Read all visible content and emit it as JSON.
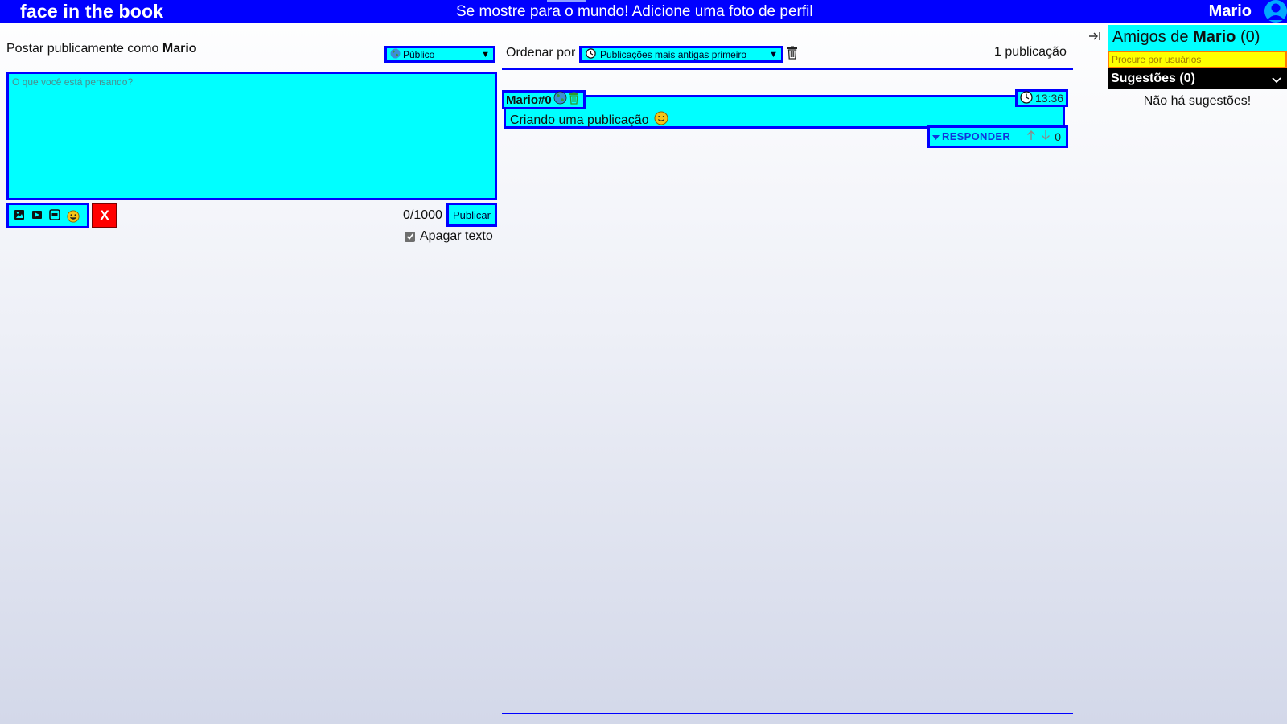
{
  "header": {
    "brand": "face in the book",
    "banner": "Se mostre para o mundo! Adicione uma foto de perfil",
    "user_name": "Mario"
  },
  "composer": {
    "title_prefix": "Postar publicamente como",
    "title_user": "Mario",
    "privacy": {
      "selected": "Público",
      "icon": "globe-icon"
    },
    "placeholder": "O que você está pensando?",
    "text": "",
    "media_buttons": [
      "image-icon",
      "video-icon",
      "gif-icon",
      "emoji-icon"
    ],
    "clear_label": "X",
    "char_count": "0/1000",
    "publish_label": "Publicar",
    "clear_text_label": "Apagar texto",
    "clear_text_checked": true
  },
  "feed": {
    "sort_label": "Ordenar por",
    "sort_selected": "Publicações mais antigas primeiro",
    "post_count": "1 publicação",
    "posts": [
      {
        "author": "Mario#0",
        "time": "13:36",
        "text": "Criando uma publicação",
        "reply_label": "RESPONDER",
        "votes": "0"
      }
    ]
  },
  "friends": {
    "title_prefix": "Amigos de",
    "title_user": "Mario",
    "title_count": "(0)",
    "search_placeholder": "Procure por usuários",
    "suggestions_label": "Sugestões (0)",
    "no_suggestions": "Não há sugestões!"
  },
  "colors": {
    "primary": "#0000ff",
    "accent": "#00ffff",
    "danger": "#ff0000",
    "search_bg": "#ffff00"
  }
}
